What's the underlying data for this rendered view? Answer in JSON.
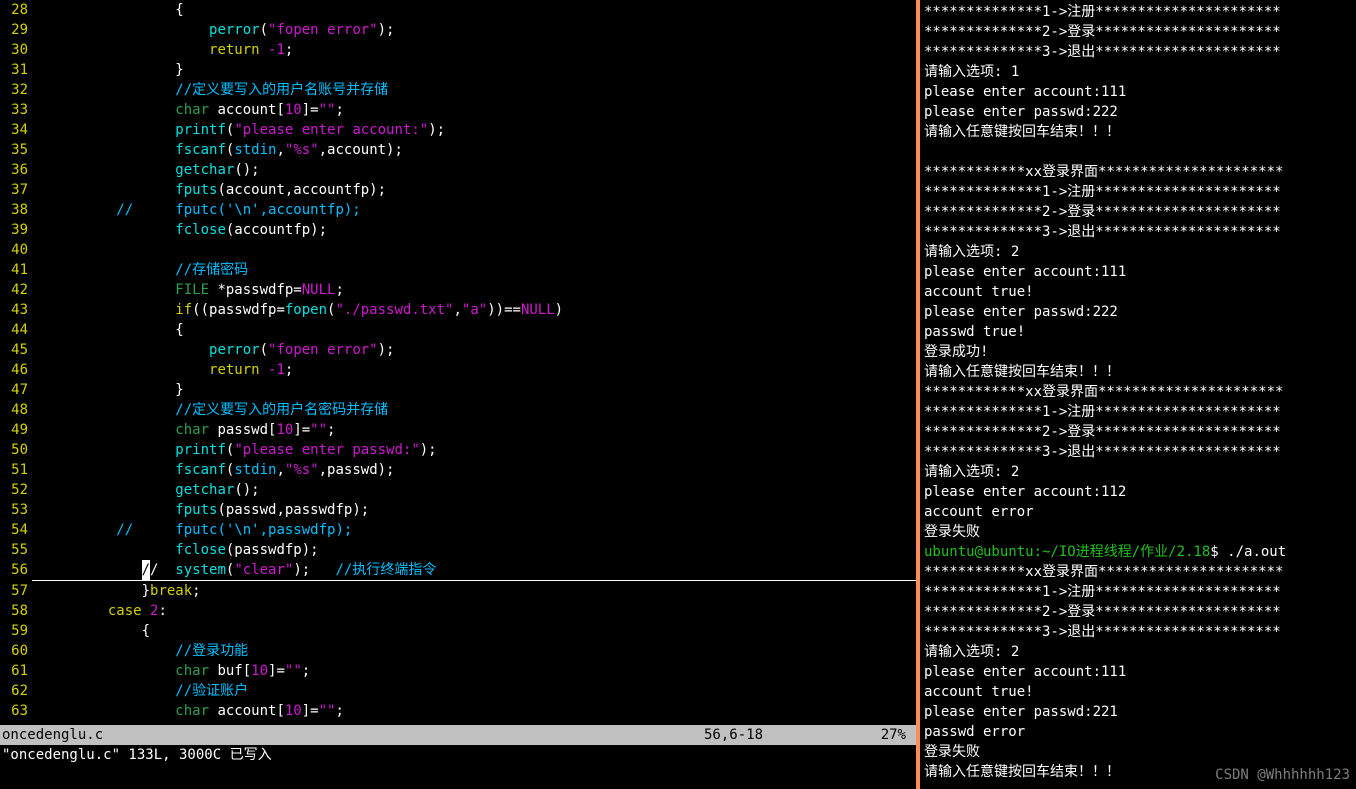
{
  "editor": {
    "filename_tab": "oncedenglu.c",
    "status_position": "56,6-18",
    "status_percent": "27%",
    "status_message": "\"oncedenglu.c\" 133L, 3000C 已写入",
    "lines": [
      {
        "n": 28,
        "html": "                {"
      },
      {
        "n": 29,
        "html": "                    <span class='fn'>perror</span>(<span class='str'>\"fopen error\"</span>);"
      },
      {
        "n": 30,
        "html": "                    <span class='kw'>return</span> <span class='num'>-1</span>;"
      },
      {
        "n": 31,
        "html": "                }"
      },
      {
        "n": 32,
        "html": "                <span class='cmt'>//定义要写入的用户名账号并存储</span>"
      },
      {
        "n": 33,
        "html": "                <span class='type'>char</span> account[<span class='num'>10</span>]=<span class='str'>\"\"</span>;"
      },
      {
        "n": 34,
        "html": "                <span class='fn'>printf</span>(<span class='str'>\"please enter account:\"</span>);"
      },
      {
        "n": 35,
        "html": "                <span class='fn'>fscanf</span>(<span class='fn2'>stdin</span>,<span class='str'>\"%s\"</span>,account);"
      },
      {
        "n": 36,
        "html": "                <span class='fn'>getchar</span>();"
      },
      {
        "n": 37,
        "html": "                <span class='fn'>fputs</span>(account,accountfp);"
      },
      {
        "n": 38,
        "html": "         <span class='cmt'>//     fputc('\\n',accountfp);</span>"
      },
      {
        "n": 39,
        "html": "                <span class='fn'>fclose</span>(accountfp);"
      },
      {
        "n": 40,
        "html": ""
      },
      {
        "n": 41,
        "html": "                <span class='cmt'>//存储密码</span>"
      },
      {
        "n": 42,
        "html": "                <span class='type'>FILE</span> *passwdfp=<span class='null'>NULL</span>;"
      },
      {
        "n": 43,
        "html": "                <span class='kw'>if</span>((passwdfp=<span class='fn'>fopen</span>(<span class='str'>\"./passwd.txt\"</span>,<span class='str'>\"a\"</span>))==<span class='null'>NULL</span>)"
      },
      {
        "n": 44,
        "html": "                {"
      },
      {
        "n": 45,
        "html": "                    <span class='fn'>perror</span>(<span class='str'>\"fopen error\"</span>);"
      },
      {
        "n": 46,
        "html": "                    <span class='kw'>return</span> <span class='num'>-1</span>;"
      },
      {
        "n": 47,
        "html": "                }"
      },
      {
        "n": 48,
        "html": "                <span class='cmt'>//定义要写入的用户名密码并存储</span>"
      },
      {
        "n": 49,
        "html": "                <span class='type'>char</span> passwd[<span class='num'>10</span>]=<span class='str'>\"\"</span>;"
      },
      {
        "n": 50,
        "html": "                <span class='fn'>printf</span>(<span class='str'>\"please enter passwd:\"</span>);"
      },
      {
        "n": 51,
        "html": "                <span class='fn'>fscanf</span>(<span class='fn2'>stdin</span>,<span class='str'>\"%s\"</span>,passwd);"
      },
      {
        "n": 52,
        "html": "                <span class='fn'>getchar</span>();"
      },
      {
        "n": 53,
        "html": "                <span class='fn'>fputs</span>(passwd,passwdfp);"
      },
      {
        "n": 54,
        "html": "         <span class='cmt'>//     fputc('\\n',passwdfp);</span>"
      },
      {
        "n": 55,
        "html": "                <span class='fn'>fclose</span>(passwdfp);"
      },
      {
        "n": 56,
        "html": "            <span class='cursor-block'>/</span>/  <span class='fn'>system</span>(<span class='str'>\"clear\"</span>);   <span class='cmt'>//执行终端指令</span>",
        "underline": true
      },
      {
        "n": 57,
        "html": "            }<span class='kw'>break</span>;"
      },
      {
        "n": 58,
        "html": "        <span class='kw'>case</span> <span class='num'>2</span>:"
      },
      {
        "n": 59,
        "html": "            {"
      },
      {
        "n": 60,
        "html": "                <span class='cmt'>//登录功能</span>"
      },
      {
        "n": 61,
        "html": "                <span class='type'>char</span> buf[<span class='num'>10</span>]=<span class='str'>\"\"</span>;"
      },
      {
        "n": 62,
        "html": "                <span class='cmt'>//验证账户</span>"
      },
      {
        "n": 63,
        "html": "                <span class='type'>char</span> account[<span class='num'>10</span>]=<span class='str'>\"\"</span>;"
      }
    ]
  },
  "terminal": {
    "lines": [
      "**************1->注册**********************",
      "**************2->登录**********************",
      "**************3->退出**********************",
      "请输入选项: 1",
      "please enter account:111",
      "please enter passwd:222",
      "请输入任意键按回车结束！！！",
      "",
      "************xx登录界面**********************",
      "**************1->注册**********************",
      "**************2->登录**********************",
      "**************3->退出**********************",
      "请输入选项: 2",
      "please enter account:111",
      "account true!",
      "please enter passwd:222",
      "passwd true!",
      "登录成功!",
      "请输入任意键按回车结束！！！",
      "************xx登录界面**********************",
      "**************1->注册**********************",
      "**************2->登录**********************",
      "**************3->退出**********************",
      "请输入选项: 2",
      "please enter account:112",
      "account error",
      "登录失败",
      {
        "green": "ubuntu@ubuntu:~/IO进程线程/作业/2.18",
        "rest": "$ ./a.out"
      },
      "************xx登录界面**********************",
      "**************1->注册**********************",
      "**************2->登录**********************",
      "**************3->退出**********************",
      "请输入选项: 2",
      "please enter account:111",
      "account true!",
      "please enter passwd:221",
      "passwd error",
      "登录失败",
      "请输入任意键按回车结束！！！"
    ]
  },
  "watermark": "CSDN @Whhhhhh123"
}
